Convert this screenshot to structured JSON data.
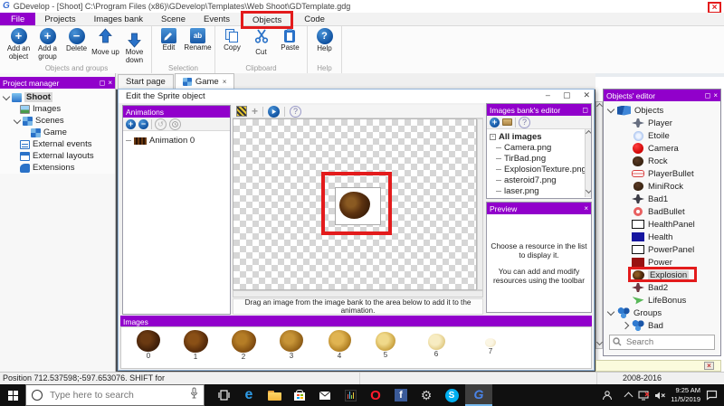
{
  "titlebar": {
    "app_title": "GDevelop - [Shoot] C:\\Program Files (x86)\\GDevelop\\Templates\\Web Shoot\\GDTemplate.gdg"
  },
  "menubar": {
    "items": [
      {
        "label": "File"
      },
      {
        "label": "Projects"
      },
      {
        "label": "Images bank"
      },
      {
        "label": "Scene"
      },
      {
        "label": "Events"
      },
      {
        "label": "Objects"
      },
      {
        "label": "Code"
      }
    ],
    "active_item": "File",
    "annotated_item": "Objects"
  },
  "ribbon": {
    "groups": [
      {
        "label": "Objects and groups",
        "buttons": [
          {
            "label": "Add an object"
          },
          {
            "label": "Add a group"
          },
          {
            "label": "Delete"
          },
          {
            "label": "Move up"
          },
          {
            "label": "Move down"
          }
        ]
      },
      {
        "label": "Selection",
        "buttons": [
          {
            "label": "Edit"
          },
          {
            "label": "Rename"
          }
        ]
      },
      {
        "label": "Clipboard",
        "buttons": [
          {
            "label": "Copy"
          },
          {
            "label": "Cut"
          },
          {
            "label": "Paste"
          }
        ]
      },
      {
        "label": "Help",
        "buttons": [
          {
            "label": "Help"
          }
        ]
      }
    ]
  },
  "project_manager": {
    "title": "Project manager",
    "tree": {
      "root": "Shoot",
      "images": "Images",
      "scenes": "Scenes",
      "game": "Game",
      "external_events": "External events",
      "external_layouts": "External layouts",
      "extensions": "Extensions"
    }
  },
  "mdi": {
    "tabs": [
      {
        "label": "Start page"
      },
      {
        "label": "Game"
      }
    ]
  },
  "sprite_dialog": {
    "title": "Edit the Sprite object",
    "animations": {
      "title": "Animations",
      "item_label": "Animation 0"
    },
    "drag_hint": "Drag an image from the image bank to the area below to add it to the animation.",
    "images_bank": {
      "title": "Images bank's editor",
      "root_label": "All images",
      "files": [
        {
          "name": "Camera.png"
        },
        {
          "name": "TirBad.png"
        },
        {
          "name": "ExplosionTexture.png"
        },
        {
          "name": "asteroid7.png"
        },
        {
          "name": "laser.png"
        }
      ]
    },
    "preview": {
      "title": "Preview",
      "message_line1": "Choose a resource in the list to display it.",
      "message_line2": "You can add and modify resources using the toolbar"
    },
    "images_strip": {
      "title": "Images",
      "frames": [
        {
          "index": "0"
        },
        {
          "index": "1"
        },
        {
          "index": "2"
        },
        {
          "index": "3"
        },
        {
          "index": "4"
        },
        {
          "index": "5"
        },
        {
          "index": "6"
        },
        {
          "index": "7"
        }
      ]
    }
  },
  "objects_editor": {
    "title": "Objects' editor",
    "root_label": "Objects",
    "items": [
      {
        "label": "Player"
      },
      {
        "label": "Etoile"
      },
      {
        "label": "Camera"
      },
      {
        "label": "Rock"
      },
      {
        "label": "PlayerBullet"
      },
      {
        "label": "MiniRock"
      },
      {
        "label": "Bad1"
      },
      {
        "label": "BadBullet"
      },
      {
        "label": "HealthPanel"
      },
      {
        "label": "Health"
      },
      {
        "label": "PowerPanel"
      },
      {
        "label": "Power"
      },
      {
        "label": "Explosion"
      },
      {
        "label": "Bad2"
      },
      {
        "label": "LifeBonus"
      }
    ],
    "selected_item": "Explosion",
    "groups_label": "Groups",
    "group_items": [
      {
        "label": "Bad"
      }
    ],
    "search_placeholder": "Search"
  },
  "statusbar": {
    "position_text": "Position 712.537598;-597.653076. SHIFT for",
    "copyright": "2008-2016"
  },
  "taskbar": {
    "search_placeholder": "Type here to search",
    "clock": {
      "time": "9:25 AM",
      "date": "11/5/2019"
    }
  },
  "colors": {
    "accent_purple": "#9100CB",
    "icon_blue": "#1A5AA8",
    "annotation_red": "#E31B1C",
    "selection_gray": "#D8D8D8",
    "mdi_background": "#4E5257",
    "taskbar_black": "#101010"
  }
}
